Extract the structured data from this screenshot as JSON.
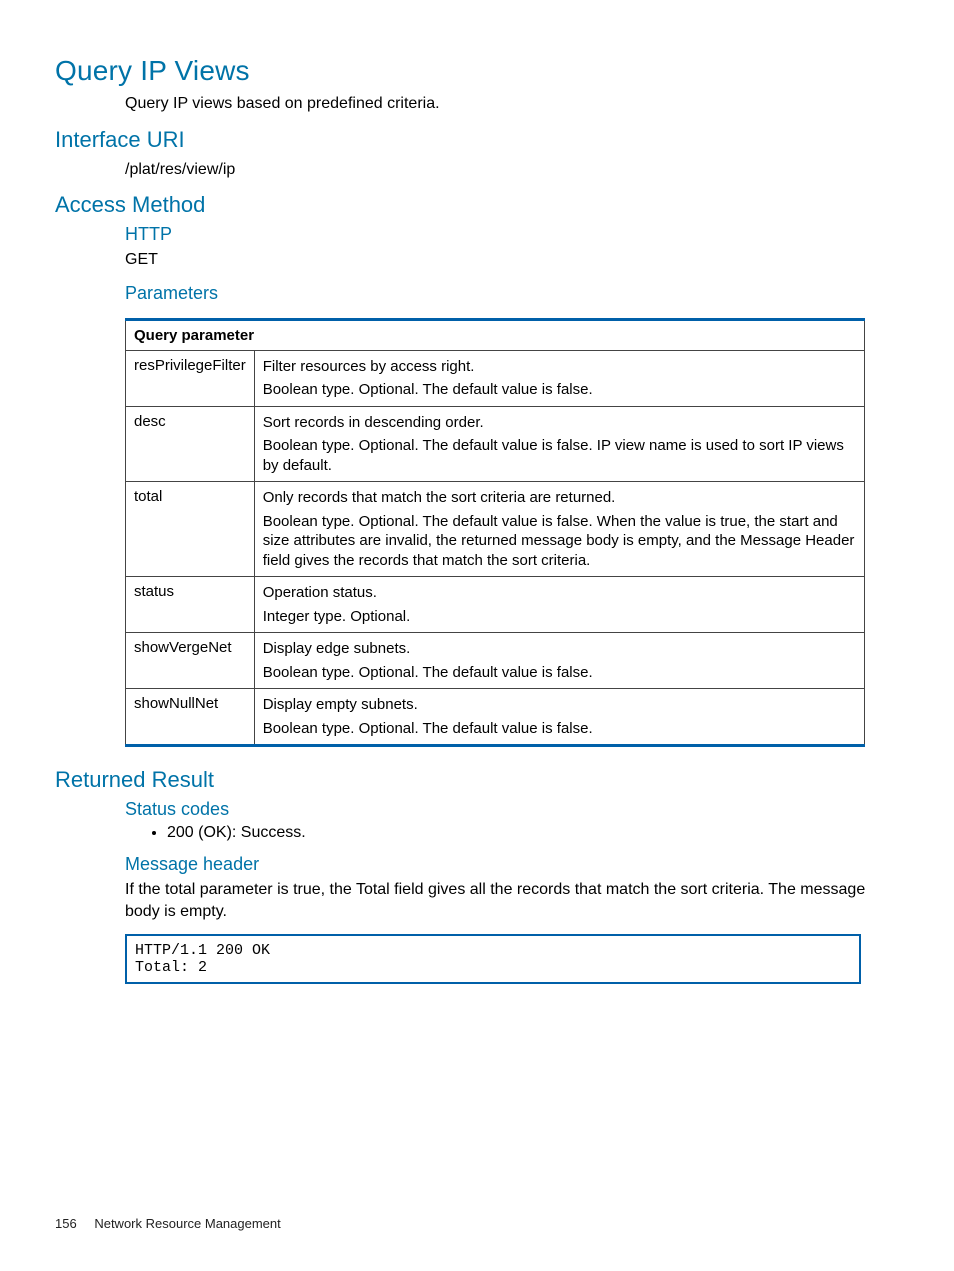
{
  "title": "Query IP Views",
  "intro": "Query IP views based on predefined criteria.",
  "interface_uri_heading": "Interface URI",
  "interface_uri_value": "/plat/res/view/ip",
  "access_method_heading": "Access Method",
  "http_heading": "HTTP",
  "http_value": "GET",
  "parameters_heading": "Parameters",
  "table_header": "Query parameter",
  "parameters": [
    {
      "name": "resPrivilegeFilter",
      "line1": "Filter resources by access right.",
      "line2": "Boolean type. Optional. The default value is false."
    },
    {
      "name": "desc",
      "line1": "Sort records in descending order.",
      "line2": "Boolean type. Optional. The default value is false. IP view name is used to sort IP views by default."
    },
    {
      "name": "total",
      "line1": "Only records that match the sort criteria are returned.",
      "line2": "Boolean type. Optional. The default value is false. When the value is true, the start and size attributes are invalid, the returned message body is empty, and the Message Header field gives the records that match the sort criteria."
    },
    {
      "name": "status",
      "line1": "Operation status.",
      "line2": "Integer type. Optional."
    },
    {
      "name": "showVergeNet",
      "line1": "Display edge subnets.",
      "line2": "Boolean type. Optional. The default value is false."
    },
    {
      "name": "showNullNet",
      "line1": "Display empty subnets.",
      "line2": "Boolean type. Optional. The default value is false."
    }
  ],
  "returned_result_heading": "Returned Result",
  "status_codes_heading": "Status codes",
  "status_code_item": "200 (OK): Success.",
  "message_header_heading": "Message header",
  "message_header_text": "If the total parameter is true, the Total field gives all the records that match the sort criteria. The message body is empty.",
  "code_block": "HTTP/1.1 200 OK\nTotal: 2",
  "footer_page": "156",
  "footer_text": "Network Resource Management"
}
